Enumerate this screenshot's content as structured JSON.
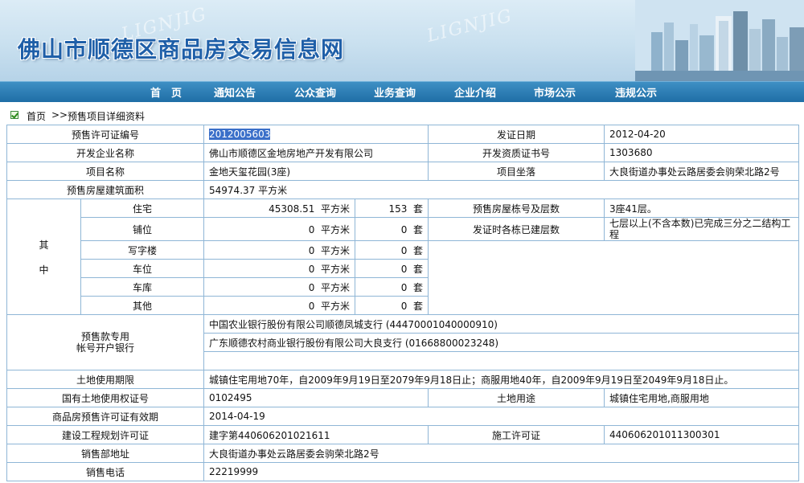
{
  "header": {
    "site_title": "佛山市顺德区商品房交易信息网",
    "watermark": "LIGNJIG"
  },
  "nav": {
    "items": [
      "首　页",
      "通知公告",
      "公众查询",
      "业务查询",
      "企业介绍",
      "市场公示",
      "违规公示"
    ]
  },
  "breadcrumb": {
    "home": "首页",
    "separator": ">>",
    "current": "预售项目详细资料"
  },
  "detail": {
    "permit_no_label": "预售许可证编号",
    "permit_no": "2012005603",
    "issue_date_label": "发证日期",
    "issue_date": "2012-04-20",
    "developer_label": "开发企业名称",
    "developer": "佛山市顺德区金地房地产开发有限公司",
    "qualification_label": "开发资质证书号",
    "qualification": "1303680",
    "project_name_label": "项目名称",
    "project_name": "金地天玺花园(3座)",
    "location_label": "项目坐落",
    "location": "大良街道办事处云路居委会驹荣北路2号",
    "area_label": "预售房屋建筑面积",
    "area": "54974.37 平方米",
    "breakdown_label": "其　中",
    "breakdown_label_1": "其",
    "breakdown_label_2": "中",
    "unit_area": "平方米",
    "unit_count": "套",
    "breakdown": [
      {
        "type": "住宅",
        "area": "45308.51",
        "count": "153"
      },
      {
        "type": "铺位",
        "area": "0",
        "count": "0"
      },
      {
        "type": "写字楼",
        "area": "0",
        "count": "0"
      },
      {
        "type": "车位",
        "area": "0",
        "count": "0"
      },
      {
        "type": "车库",
        "area": "0",
        "count": "0"
      },
      {
        "type": "其他",
        "area": "0",
        "count": "0"
      }
    ],
    "building_label": "预售房屋栋号及层数",
    "building": "3座41层。",
    "built_floors_label": "发证时各栋已建层数",
    "built_floors": "七层以上(不含本数)已完成三分之二结构工程",
    "bank_label_1": "预售款专用",
    "bank_label_2": "帐号开户银行",
    "banks": [
      "中国农业银行股份有限公司顺德凤城支行 (44470001040000910)",
      "广东顺德农村商业银行股份有限公司大良支行 (01668800023248)"
    ],
    "land_period_label": "土地使用期限",
    "land_period": "城镇住宅用地70年，自2009年9月19日至2079年9月18日止；商服用地40年，自2009年9月19日至2049年9月18日止。",
    "land_cert_label": "国有土地使用权证号",
    "land_cert": "0102495",
    "land_use_label": "土地用途",
    "land_use": "城镇住宅用地,商服用地",
    "validity_label": "商品房预售许可证有效期",
    "validity": "2014-04-19",
    "planning_label": "建设工程规划许可证",
    "planning": "建字第440606201021611",
    "construction_label": "施工许可证",
    "construction": "440606201011300301",
    "sales_addr_label": "销售部地址",
    "sales_addr": "大良街道办事处云路居委会驹荣北路2号",
    "sales_tel_label": "销售电话",
    "sales_tel": "22219999"
  },
  "colors": {
    "nav_bg": "#1f6ea6",
    "title": "#1f5fa8",
    "border": "#8fb6d6",
    "selection": "#3a6fc9"
  }
}
